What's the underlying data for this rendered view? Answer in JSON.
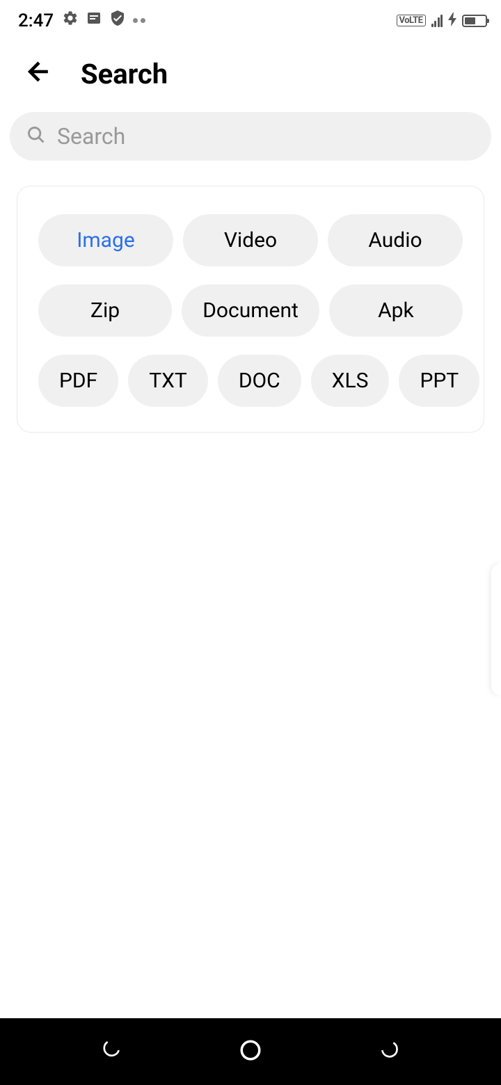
{
  "status_bar": {
    "time": "2:47"
  },
  "header": {
    "title": "Search"
  },
  "search": {
    "placeholder": "Search",
    "value": ""
  },
  "filters": {
    "row1": [
      {
        "label": "Image",
        "active": true
      },
      {
        "label": "Video",
        "active": false
      },
      {
        "label": "Audio",
        "active": false
      }
    ],
    "row2": [
      {
        "label": "Zip",
        "active": false
      },
      {
        "label": "Document",
        "active": false
      },
      {
        "label": "Apk",
        "active": false
      }
    ],
    "row3": [
      {
        "label": "PDF",
        "active": false
      },
      {
        "label": "TXT",
        "active": false
      },
      {
        "label": "DOC",
        "active": false
      },
      {
        "label": "XLS",
        "active": false
      },
      {
        "label": "PPT",
        "active": false
      }
    ]
  }
}
